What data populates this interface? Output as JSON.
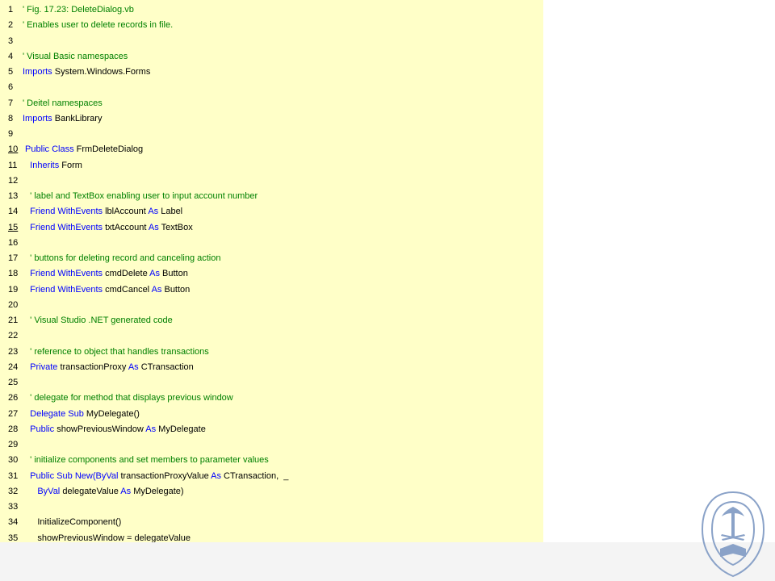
{
  "code": {
    "lines": [
      {
        "num": "1",
        "segments": [
          [
            "cm",
            "' Fig. 17.23: DeleteDialog.vb"
          ]
        ]
      },
      {
        "num": "2",
        "segments": [
          [
            "cm",
            "' Enables user to delete records in file."
          ]
        ]
      },
      {
        "num": "3",
        "segments": []
      },
      {
        "num": "4",
        "segments": [
          [
            "cm",
            "' Visual Basic namespaces"
          ]
        ]
      },
      {
        "num": "5",
        "segments": [
          [
            "kw",
            "Imports"
          ],
          [
            "pl",
            " System.Windows.Forms"
          ]
        ]
      },
      {
        "num": "6",
        "segments": []
      },
      {
        "num": "7",
        "segments": [
          [
            "cm",
            "' Deitel namespaces"
          ]
        ]
      },
      {
        "num": "8",
        "segments": [
          [
            "kw",
            "Imports"
          ],
          [
            "pl",
            " BankLibrary"
          ]
        ]
      },
      {
        "num": "9",
        "segments": []
      },
      {
        "num": "10",
        "underline": true,
        "segments": [
          [
            "kw",
            " Public Class"
          ],
          [
            "pl",
            " FrmDeleteDialog"
          ]
        ]
      },
      {
        "num": "11",
        "segments": [
          [
            "kw",
            "   Inherits"
          ],
          [
            "pl",
            " Form"
          ]
        ]
      },
      {
        "num": "12",
        "segments": []
      },
      {
        "num": "13",
        "segments": [
          [
            "cm",
            "   ' label and TextBox enabling user to input account number"
          ]
        ]
      },
      {
        "num": "14",
        "segments": [
          [
            "kw",
            "   Friend WithEvents"
          ],
          [
            "pl",
            " lblAccount "
          ],
          [
            "kw",
            "As"
          ],
          [
            "pl",
            " Label"
          ]
        ]
      },
      {
        "num": "15",
        "underline": true,
        "segments": [
          [
            "kw",
            "   Friend WithEvents"
          ],
          [
            "pl",
            " txtAccount "
          ],
          [
            "kw",
            "As"
          ],
          [
            "pl",
            " TextBox"
          ]
        ]
      },
      {
        "num": "16",
        "segments": []
      },
      {
        "num": "17",
        "segments": [
          [
            "cm",
            "   ' buttons for deleting record and canceling action"
          ]
        ]
      },
      {
        "num": "18",
        "segments": [
          [
            "kw",
            "   Friend WithEvents"
          ],
          [
            "pl",
            " cmdDelete "
          ],
          [
            "kw",
            "As"
          ],
          [
            "pl",
            " Button"
          ]
        ]
      },
      {
        "num": "19",
        "segments": [
          [
            "kw",
            "   Friend WithEvents"
          ],
          [
            "pl",
            " cmdCancel "
          ],
          [
            "kw",
            "As"
          ],
          [
            "pl",
            " Button"
          ]
        ]
      },
      {
        "num": "20",
        "segments": []
      },
      {
        "num": "21",
        "segments": [
          [
            "cm",
            "   ' Visual Studio .NET generated code"
          ]
        ]
      },
      {
        "num": "22",
        "segments": []
      },
      {
        "num": "23",
        "segments": [
          [
            "cm",
            "   ' reference to object that handles transactions"
          ]
        ]
      },
      {
        "num": "24",
        "segments": [
          [
            "kw",
            "   Private"
          ],
          [
            "pl",
            " transactionProxy "
          ],
          [
            "kw",
            "As"
          ],
          [
            "pl",
            " CTransaction"
          ]
        ]
      },
      {
        "num": "25",
        "segments": []
      },
      {
        "num": "26",
        "segments": [
          [
            "cm",
            "   ' delegate for method that displays previous window"
          ]
        ]
      },
      {
        "num": "27",
        "segments": [
          [
            "kw",
            "   Delegate Sub"
          ],
          [
            "pl",
            " MyDelegate()"
          ]
        ]
      },
      {
        "num": "28",
        "segments": [
          [
            "kw",
            "   Public"
          ],
          [
            "pl",
            " showPreviousWindow "
          ],
          [
            "kw",
            "As"
          ],
          [
            "pl",
            " MyDelegate"
          ]
        ]
      },
      {
        "num": "29",
        "segments": []
      },
      {
        "num": "30",
        "segments": [
          [
            "cm",
            "   ' initialize components and set members to parameter values"
          ]
        ]
      },
      {
        "num": "31",
        "segments": [
          [
            "kw",
            "   Public Sub New("
          ],
          [
            "kw",
            "ByVal"
          ],
          [
            "pl",
            " transactionProxyValue "
          ],
          [
            "kw",
            "As"
          ],
          [
            "pl",
            " CTransaction,  _"
          ]
        ]
      },
      {
        "num": "32",
        "segments": [
          [
            "kw",
            "      ByVal"
          ],
          [
            "pl",
            " delegateValue "
          ],
          [
            "kw",
            "As"
          ],
          [
            "pl",
            " MyDelegate)"
          ]
        ]
      },
      {
        "num": "33",
        "segments": []
      },
      {
        "num": "34",
        "segments": [
          [
            "pl",
            "      InitializeComponent()"
          ]
        ]
      },
      {
        "num": "35",
        "segments": [
          [
            "pl",
            "      showPreviousWindow = delegateValue"
          ]
        ]
      }
    ]
  },
  "logo": {
    "icon": "university-seal-icon",
    "color": "#8aa2c8"
  }
}
